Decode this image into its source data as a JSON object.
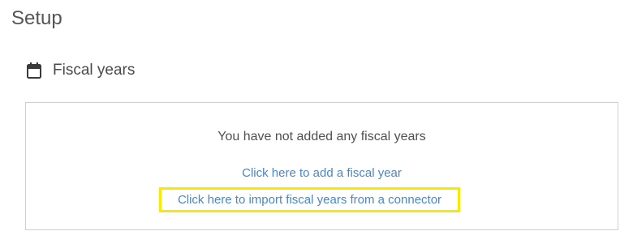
{
  "page": {
    "title": "Setup"
  },
  "section": {
    "icon": "calendar-icon",
    "title": "Fiscal years"
  },
  "empty_state": {
    "message": "You have not added any fiscal years",
    "add_link": "Click here to add a fiscal year",
    "import_link": "Click here to import fiscal years from a connector"
  },
  "colors": {
    "link": "#4a86c8",
    "highlight": "#f5ea00",
    "border": "#cfcfcf"
  }
}
